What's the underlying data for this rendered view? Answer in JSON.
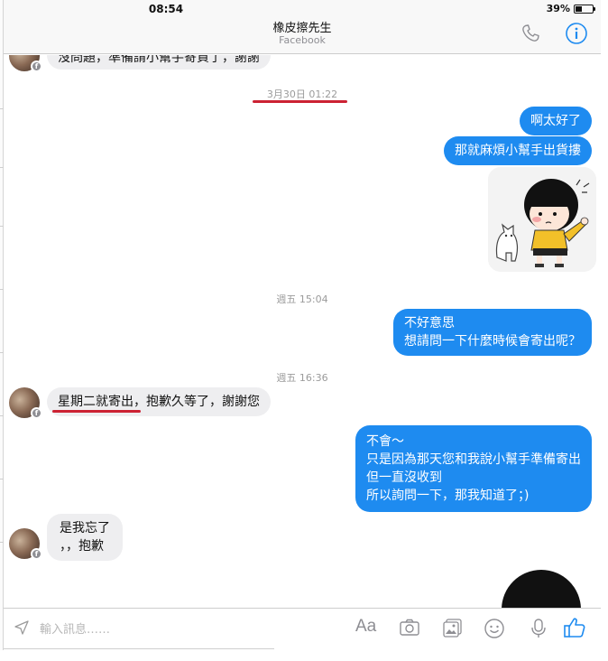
{
  "status_bar": {
    "time": "08:54",
    "battery": "39%",
    "battery_level": 0.39
  },
  "header": {
    "title": "橡皮擦先生",
    "subtitle": "Facebook",
    "icons": [
      "phone-icon",
      "info-icon"
    ]
  },
  "messages": {
    "m0_partial": "沒問題，準備請小幫手寄貨了，謝謝",
    "stamp1": "3月30日 01:22",
    "o1": "啊太好了",
    "o2": "那就麻煩小幫手出貨摟",
    "stamp2": "週五 15:04",
    "o3": "不好意思\n想請問一下什麼時候會寄出呢？",
    "stamp3": "週五 16:36",
    "i1_highlight": "星期二就寄出",
    "i1_rest": "，抱歉久等了，謝謝您",
    "o4": "不會～\n只是因為那天您和我說小幫手準備寄出\n但一直沒收到\n所以詢問一下，那我知道了；)",
    "i2": "是我忘了\n，，抱歉"
  },
  "composer": {
    "placeholder": "輸入訊息……",
    "font_button": "Aa",
    "icons": [
      "send-location-icon",
      "camera-icon",
      "image-icon",
      "emoji-icon",
      "microphone-icon",
      "like-icon"
    ]
  },
  "colors": {
    "outgoing": "#1e8bf0",
    "incoming": "#eeeef0",
    "highlight": "#cc2233",
    "icon": "#7b7b7b",
    "accent": "#1e8bf0"
  }
}
